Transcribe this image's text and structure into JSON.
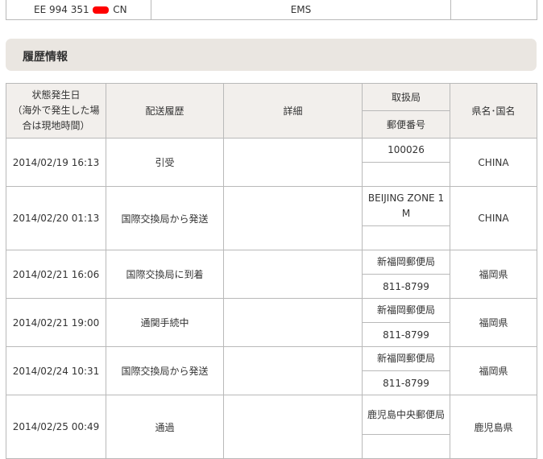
{
  "summary": {
    "tracking_number_prefix": "EE 994 351",
    "tracking_number_suffix": "CN",
    "service": "EMS",
    "redaction_color": "#ff0000"
  },
  "section": {
    "title": "履歴情報"
  },
  "columns": {
    "date_line1": "状態発生日",
    "date_line2": "（海外で発生した場",
    "date_line3": "合は現地時間）",
    "history": "配送履歴",
    "detail": "詳細",
    "office": "取扱局",
    "postal": "郵便番号",
    "region": "県名･国名"
  },
  "rows": [
    {
      "date": "2014/02/19 16:13",
      "history": "引受",
      "detail": "",
      "office": "100026",
      "postal": "",
      "region": "CHINA"
    },
    {
      "date": "2014/02/20 01:13",
      "history": "国際交換局から発送",
      "detail": "",
      "office": "BEIJING ZONE 1 M",
      "postal": "",
      "region": "CHINA"
    },
    {
      "date": "2014/02/21 16:06",
      "history": "国際交換局に到着",
      "detail": "",
      "office": "新福岡郵便局",
      "postal": "811-8799",
      "region": "福岡県"
    },
    {
      "date": "2014/02/21 19:00",
      "history": "通関手続中",
      "detail": "",
      "office": "新福岡郵便局",
      "postal": "811-8799",
      "region": "福岡県"
    },
    {
      "date": "2014/02/24 10:31",
      "history": "国際交換局から発送",
      "detail": "",
      "office": "新福岡郵便局",
      "postal": "811-8799",
      "region": "福岡県"
    },
    {
      "date": "2014/02/25 00:49",
      "history": "通過",
      "detail": "",
      "office": "鹿児島中央郵便局",
      "postal": "",
      "region": "鹿児島県"
    }
  ]
}
